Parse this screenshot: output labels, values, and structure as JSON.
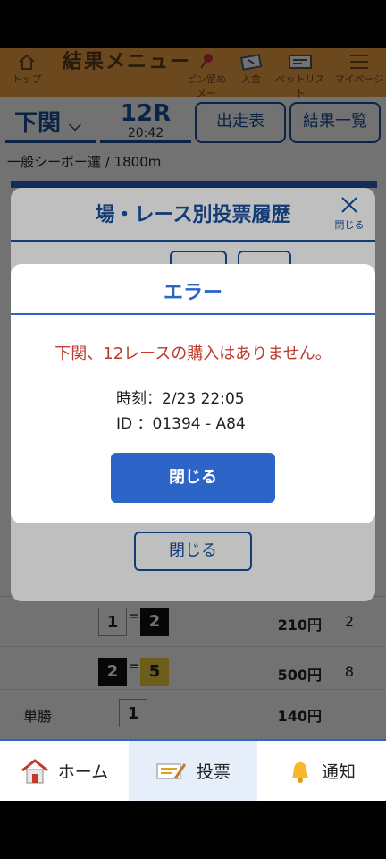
{
  "top_nav": {
    "top": "トップ",
    "title": "結果メニュー",
    "pin": "ピン留めメー",
    "deposit": "入金",
    "bet_list": "ベットリスト",
    "mypage": "マイページ"
  },
  "race": {
    "venue": "下関",
    "race_no": "12R",
    "time": "20:42",
    "entries_label": "出走表",
    "results_label": "結果一覧",
    "description": "一般シーボー選 / 1800m"
  },
  "results": [
    {
      "label": "",
      "nums": [
        "1",
        "2"
      ],
      "payout": "210円",
      "popularity": "2"
    },
    {
      "label": "",
      "nums": [
        "2",
        "5"
      ],
      "payout": "500円",
      "popularity": "8"
    },
    {
      "label": "単勝",
      "nums": [
        "1"
      ],
      "payout": "140円",
      "popularity": ""
    }
  ],
  "history_modal": {
    "title": "場・レース別投票履歴",
    "close_x_label": "閉じる",
    "close_button": "閉じる"
  },
  "error_modal": {
    "title": "エラー",
    "message": "下関、12レースの購入はありません。",
    "time_line": "時刻：2/23 22:05",
    "id_line": "ID ：01394 - A84",
    "close_button": "閉じる"
  },
  "tab_bar": {
    "home": "ホーム",
    "vote": "投票",
    "notice": "通知"
  },
  "colors": {
    "accent": "#2c64c8",
    "header": "#f0a043",
    "error_text": "#c0392b"
  }
}
